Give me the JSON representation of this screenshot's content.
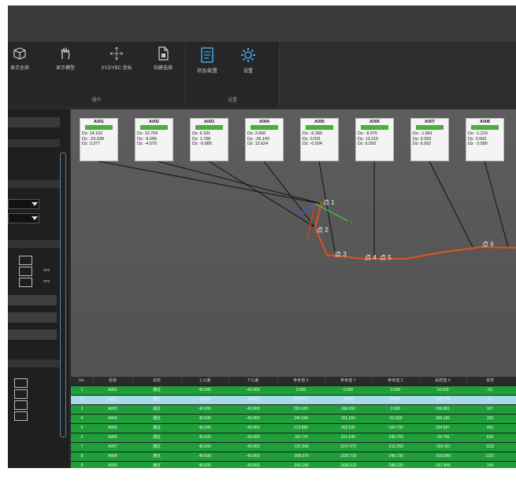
{
  "ribbon": {
    "group1_buttons": [
      {
        "icon": "cube-icon",
        "label": "显示全部"
      },
      {
        "icon": "hand-icon",
        "label": "显示模型"
      },
      {
        "icon": "move-icon",
        "label": "XYZ/YBC 坐标"
      },
      {
        "icon": "document-icon",
        "label": "创建选择"
      }
    ],
    "group1_label": "操作",
    "group2_buttons": [
      {
        "icon": "notebook-icon",
        "label": "状态/配置"
      },
      {
        "icon": "gear-icon",
        "label": "设置"
      }
    ],
    "group2_label": "设置"
  },
  "left_panel": {
    "unit_label": "mm"
  },
  "gauges": [
    {
      "name": "A001",
      "dx": "Dx: 14.102",
      "dy": "Dy: -23.038",
      "dz": "Dz: 3.377"
    },
    {
      "name": "A002",
      "dx": "Dx: 13.704",
      "dy": "Dy: -5.099",
      "dz": "Dz: -4.570"
    },
    {
      "name": "A003",
      "dx": "Dx: 6.181",
      "dy": "Dy: 1.768",
      "dz": "Dz: -5.880"
    },
    {
      "name": "A004",
      "dx": "Dx: 3.656",
      "dy": "Dy: -26.143",
      "dz": "Dz: 12.624"
    },
    {
      "name": "A005",
      "dx": "Dx: -6.283",
      "dy": "Dy: 0.031",
      "dz": "Dz: -0.504"
    },
    {
      "name": "A006",
      "dx": "Dx: -9.975",
      "dy": "Dy: 13.215",
      "dz": "Dz: 6.550"
    },
    {
      "name": "A007",
      "dx": "Dx: -1.841",
      "dy": "Dy: 3.093",
      "dz": "Dz: 6.002"
    },
    {
      "name": "A008",
      "dx": "Dx: -1.219",
      "dy": "Dy: 2.663",
      "dz": "Dz: -3.580"
    }
  ],
  "scene_labels": [
    "点 1",
    "点 2",
    "点 3",
    "点 4",
    "点 5",
    "点 6"
  ],
  "axis_labels": {
    "x": "X",
    "y": "Y",
    "z": "Z"
  },
  "colors": {
    "ok_row": "#1f9e39",
    "selected_row": "#a9dbe6",
    "gauge_ok": "#4caf3d",
    "path": "#d9531e"
  },
  "table": {
    "headers": [
      "No.",
      "名称",
      "状态",
      "上公差",
      "下公差",
      "参考值 X",
      "参考值 Y",
      "参考值 Z",
      "采样值 X",
      "采样"
    ],
    "rows": [
      [
        "1",
        "A001",
        "通过",
        "40.000",
        "-40.000",
        "0.000",
        "0.000",
        "0.000",
        "14.102",
        "-23."
      ],
      [
        "2",
        "A002",
        "通过",
        "40.000",
        "-40.000",
        "155.070",
        "0.000",
        "0.000",
        "168.774",
        "-5."
      ],
      [
        "3",
        "A003",
        "通过",
        "40.000",
        "-40.000",
        "263.620",
        "166.650",
        "0.000",
        "269.801",
        "167"
      ],
      [
        "4",
        "A004",
        "通过",
        "40.000",
        "-40.000",
        "246.540",
        "351.550",
        "-52.550",
        "250.196",
        "325"
      ],
      [
        "5",
        "A005",
        "通过",
        "40.000",
        "-40.000",
        "213.880",
        "452.530",
        "-104.730",
        "204.597",
        "452"
      ],
      [
        "6",
        "A006",
        "通过",
        "40.000",
        "-40.000",
        "-84.770",
        "621.640",
        "-296.760",
        "-94.745",
        "634"
      ],
      [
        "7",
        "A007",
        "通过",
        "40.000",
        "-40.000",
        "-191.590",
        "1107.470",
        "-312.260",
        "-193.431",
        "1110"
      ],
      [
        "8",
        "A008",
        "通过",
        "40.000",
        "-40.000",
        "-309.370",
        "1328.710",
        "-249.730",
        "-310.589",
        "1331"
      ],
      [
        "9",
        "A009",
        "通过",
        "40.000",
        "-40.000",
        "-364.180",
        "1438.610",
        "-288.220",
        "-367.845",
        "144"
      ]
    ]
  }
}
